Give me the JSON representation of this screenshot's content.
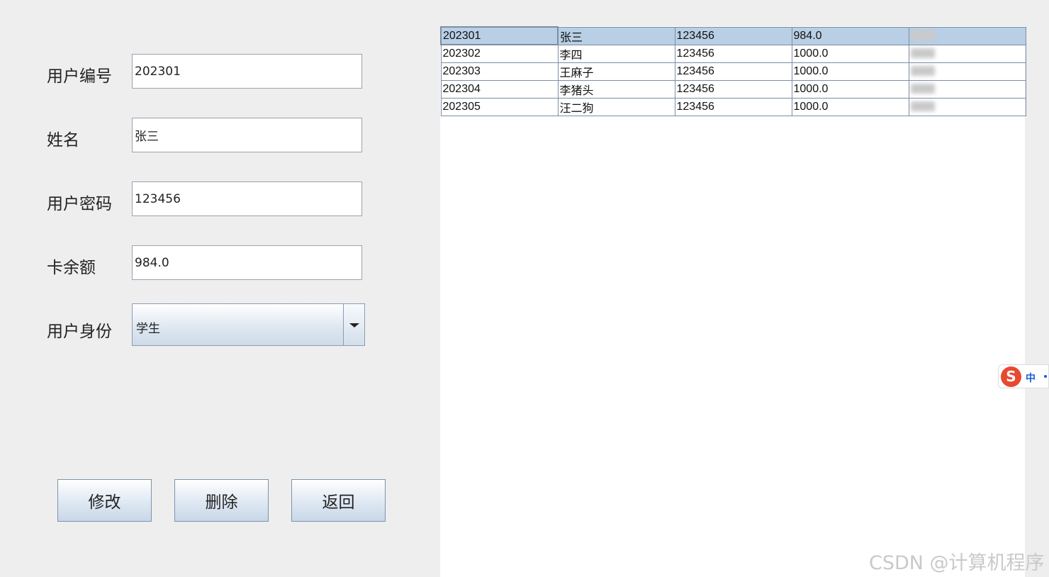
{
  "form": {
    "user_id_label": "用户编号",
    "user_id_value": "202301",
    "name_label": "姓名",
    "name_value": "张三",
    "password_label": "用户密码",
    "password_value": "123456",
    "balance_label": "卡余额",
    "balance_value": "984.0",
    "role_label": "用户身份",
    "role_selected": "学生"
  },
  "buttons": {
    "modify": "修改",
    "delete": "删除",
    "back": "返回"
  },
  "table": {
    "rows": [
      [
        "202301",
        "张三",
        "123456",
        "984.0"
      ],
      [
        "202302",
        "李四",
        "123456",
        "1000.0"
      ],
      [
        "202303",
        "王麻子",
        "123456",
        "1000.0"
      ],
      [
        "202304",
        "李猪头",
        "123456",
        "1000.0"
      ],
      [
        "202305",
        "汪二狗",
        "123456",
        "1000.0"
      ]
    ],
    "selected_row": 0
  },
  "ime": {
    "logo": "S",
    "mode": "中"
  },
  "watermark": "CSDN @计算机程序"
}
